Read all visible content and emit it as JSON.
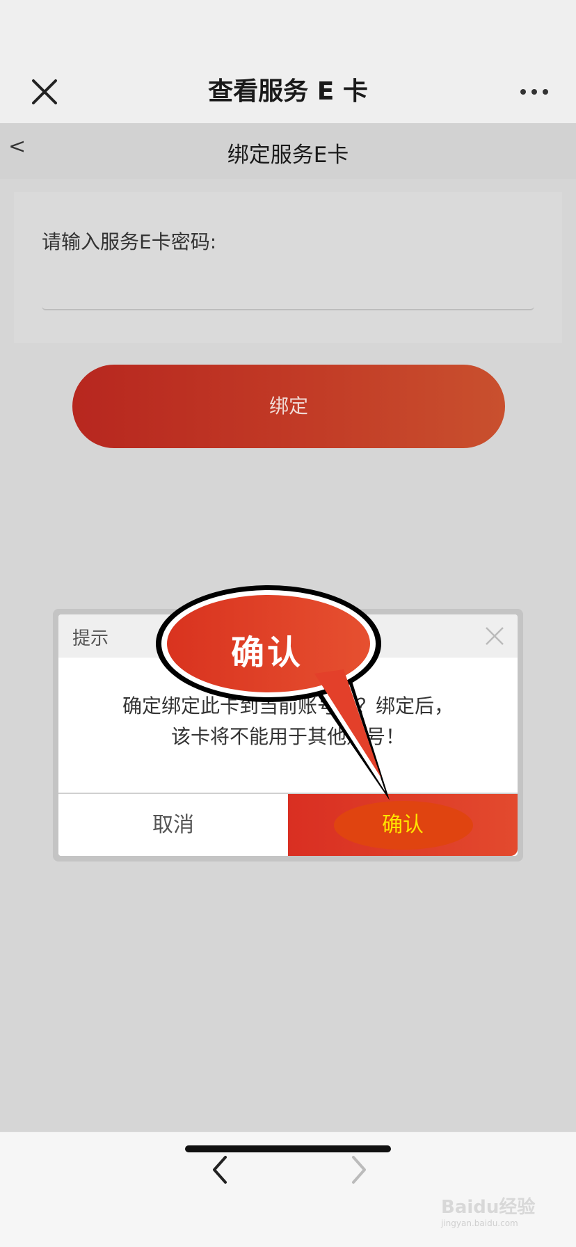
{
  "header": {
    "title": "查看服务 E 卡"
  },
  "subheader": {
    "back": "<",
    "title": "绑定服务E卡"
  },
  "form": {
    "label": "请输入服务E卡密码:",
    "password_value": "",
    "bind_button": "绑定"
  },
  "dialog": {
    "title": "提示",
    "message_line1": "确定绑定此卡到当前账号吗？绑定后，",
    "message_line2": "该卡将不能用于其他账号！",
    "cancel": "取消",
    "confirm": "确认"
  },
  "callout": {
    "text": "确认"
  },
  "watermark": {
    "brand": "Baidu经验",
    "url": "jingyan.baidu.com"
  },
  "colors": {
    "accent_red": "#c23b26",
    "confirm_text": "#ffe400",
    "callout_fill": "#e2412b"
  }
}
